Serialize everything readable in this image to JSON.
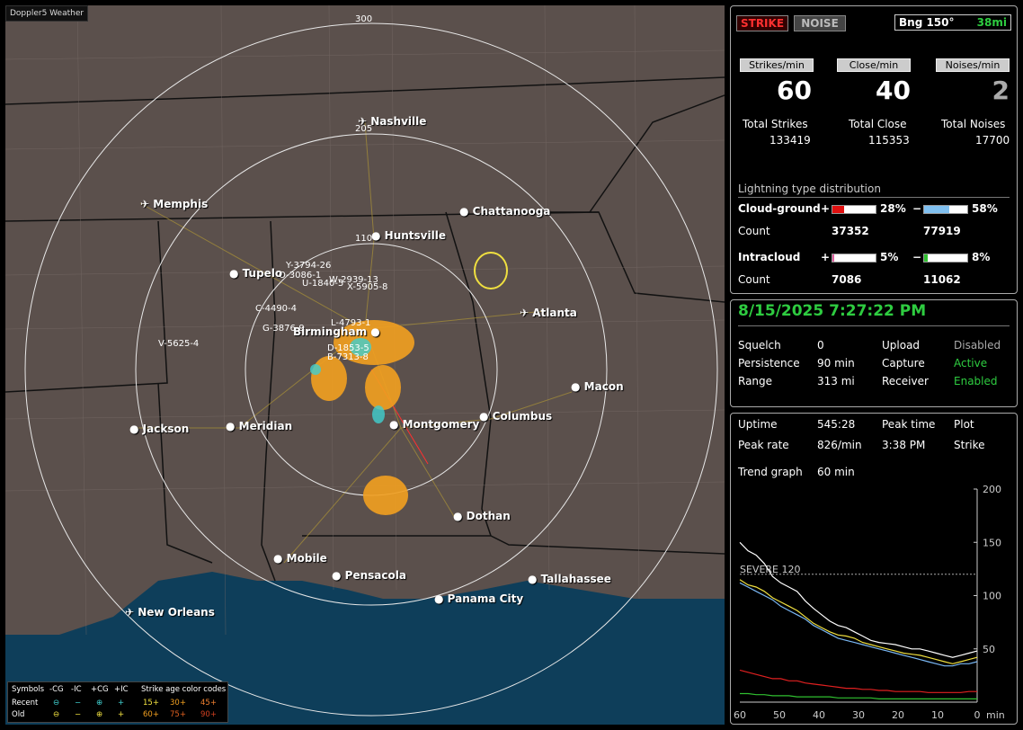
{
  "app": {
    "title": "Doppler5 Weather"
  },
  "map": {
    "range_labels": [
      "300",
      "205",
      "110"
    ],
    "cities": [
      {
        "name": "Nashville",
        "icon": "airport-icon"
      },
      {
        "name": "Memphis",
        "icon": "airport-icon"
      },
      {
        "name": "Chattanooga",
        "icon": "city-dot"
      },
      {
        "name": "Huntsville",
        "icon": "city-dot"
      },
      {
        "name": "Tupelo",
        "icon": "city-dot"
      },
      {
        "name": "Atlanta",
        "icon": "airport-icon"
      },
      {
        "name": "Birmingham",
        "icon": "city-dot"
      },
      {
        "name": "Macon",
        "icon": "city-dot"
      },
      {
        "name": "Jackson",
        "icon": "city-dot"
      },
      {
        "name": "Meridian",
        "icon": "city-dot"
      },
      {
        "name": "Montgomery",
        "icon": "city-dot"
      },
      {
        "name": "Columbus",
        "icon": "city-dot"
      },
      {
        "name": "Dothan",
        "icon": "city-dot"
      },
      {
        "name": "Mobile",
        "icon": "city-dot"
      },
      {
        "name": "Pensacola",
        "icon": "city-dot"
      },
      {
        "name": "Tallahassee",
        "icon": "city-dot"
      },
      {
        "name": "Panama City",
        "icon": "city-dot"
      },
      {
        "name": "New Orleans",
        "icon": "airport-icon"
      }
    ],
    "storm_tags": [
      "Y-3794-26",
      "O-3086-1",
      "U-1840-5",
      "W-2939-13",
      "X-5905-8",
      "C-4490-4",
      "G-3876-9",
      "V-5625-4",
      "L-4793-1",
      "D-1853-5",
      "B-7313-8"
    ]
  },
  "legend": {
    "symbols_label": "Symbols",
    "cols": [
      "-CG",
      "-IC",
      "+CG",
      "+IC"
    ],
    "recent_label": "Recent",
    "old_label": "Old",
    "age_title": "Strike age color codes",
    "recent_ages": [
      "15+",
      "30+",
      "45+"
    ],
    "old_ages": [
      "60+",
      "75+",
      "90+"
    ]
  },
  "top_panel": {
    "strike_btn": "STRIKE",
    "noise_btn": "NOISE",
    "bearing": "Bng 150°",
    "distance": "38mi",
    "headers": [
      "Strikes/min",
      "Close/min",
      "Noises/min"
    ],
    "rates": [
      "60",
      "40",
      "2"
    ],
    "total_labels": [
      "Total Strikes",
      "Total Close",
      "Total Noises"
    ],
    "totals": [
      "133419",
      "115353",
      "17700"
    ],
    "dist_title": "Lightning type distribution",
    "cg_label": "Cloud-ground",
    "ic_label": "Intracloud",
    "count_label": "Count",
    "plus": "+",
    "minus": "−",
    "cg_pos_pct": "28%",
    "cg_pos_frac": 0.28,
    "cg_neg_pct": "58%",
    "cg_neg_frac": 0.58,
    "cg_pos_count": "37352",
    "cg_neg_count": "77919",
    "ic_pos_pct": "5%",
    "ic_pos_frac": 0.05,
    "ic_neg_pct": "8%",
    "ic_neg_frac": 0.08,
    "ic_pos_count": "7086",
    "ic_neg_count": "11062"
  },
  "status_panel": {
    "datetime": "8/15/2025 7:27:22 PM",
    "squelch_label": "Squelch",
    "squelch": "0",
    "persistence_label": "Persistence",
    "persistence": "90 min",
    "range_label": "Range",
    "range": "313 mi",
    "upload_label": "Upload",
    "upload": "Disabled",
    "capture_label": "Capture",
    "capture": "Active",
    "receiver_label": "Receiver",
    "receiver": "Enabled"
  },
  "trend_panel": {
    "uptime_label": "Uptime",
    "uptime": "545:28",
    "peak_time_label": "Peak time",
    "peak_time": "3:38 PM",
    "plot_label": "Plot",
    "plot": "Strike",
    "peak_rate_label": "Peak rate",
    "peak_rate": "826/min",
    "trend_label": "Trend graph",
    "trend": "60 min",
    "severe_label": "SEVERE 120",
    "y_ticks": [
      "200",
      "150",
      "100",
      "50"
    ],
    "x_ticks": [
      "60",
      "50",
      "40",
      "30",
      "20",
      "10",
      "0"
    ],
    "x_unit": "min"
  },
  "chart_data": {
    "type": "line",
    "title": "",
    "xlabel": "min",
    "ylabel": "",
    "xlim": [
      60,
      0
    ],
    "ylim": [
      0,
      200
    ],
    "threshold": 120,
    "series": [
      {
        "color": "#ffffff",
        "values": [
          150,
          142,
          138,
          130,
          118,
          112,
          108,
          104,
          95,
          88,
          82,
          76,
          72,
          70,
          66,
          62,
          58,
          56,
          55,
          54,
          52,
          50,
          50,
          48,
          46,
          44,
          42,
          44,
          46,
          48
        ]
      },
      {
        "color": "#f0e040",
        "values": [
          115,
          110,
          108,
          104,
          98,
          94,
          90,
          86,
          80,
          74,
          70,
          66,
          63,
          62,
          60,
          56,
          54,
          52,
          50,
          48,
          46,
          45,
          44,
          42,
          40,
          38,
          36,
          38,
          40,
          42
        ]
      },
      {
        "color": "#7ab8f5",
        "values": [
          112,
          108,
          104,
          100,
          96,
          90,
          86,
          82,
          78,
          72,
          68,
          64,
          60,
          58,
          56,
          54,
          52,
          50,
          48,
          46,
          44,
          42,
          40,
          38,
          36,
          34,
          34,
          36,
          36,
          38
        ]
      },
      {
        "color": "#e02020",
        "values": [
          30,
          28,
          26,
          24,
          22,
          22,
          20,
          20,
          18,
          17,
          16,
          15,
          14,
          13,
          13,
          12,
          12,
          11,
          11,
          10,
          10,
          10,
          10,
          9,
          9,
          9,
          9,
          9,
          10,
          10
        ]
      },
      {
        "color": "#30c030",
        "values": [
          8,
          8,
          7,
          7,
          6,
          6,
          6,
          5,
          5,
          5,
          5,
          5,
          4,
          4,
          4,
          4,
          4,
          3,
          3,
          3,
          3,
          3,
          3,
          3,
          3,
          3,
          3,
          3,
          3,
          3
        ]
      }
    ]
  }
}
